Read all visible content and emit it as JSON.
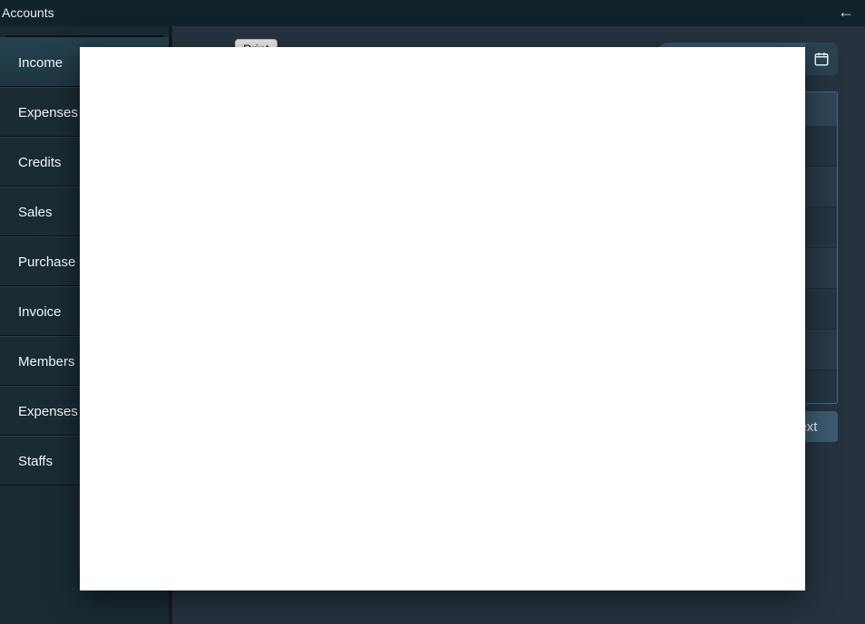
{
  "header": {
    "title": "Accounts"
  },
  "sidebar": {
    "items": [
      {
        "label": "Income"
      },
      {
        "label": "Expenses"
      },
      {
        "label": "Credits"
      },
      {
        "label": "Sales"
      },
      {
        "label": "Purchase"
      },
      {
        "label": "Invoice"
      },
      {
        "label": "Members"
      },
      {
        "label": "Expenses"
      },
      {
        "label": "Staffs"
      }
    ],
    "active_index": 0
  },
  "toolbar": {
    "print_label": "Print"
  },
  "pager": {
    "next_label": "Next"
  }
}
